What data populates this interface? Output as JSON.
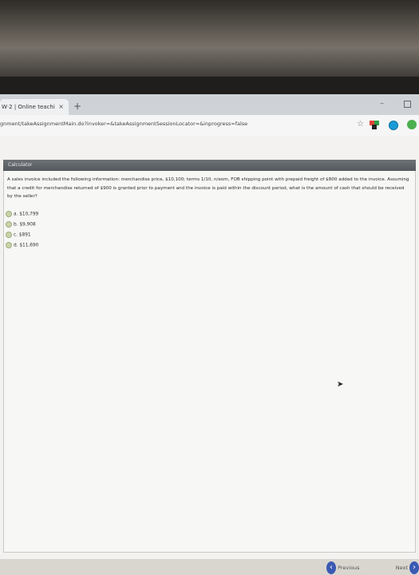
{
  "browser": {
    "tab_title": "W·2 | Online teachi",
    "tab_close": "×",
    "new_tab": "+",
    "url": "gnment/takeAssignmentMain.do?invoker=&takeAssignmentSessionLocator=&inprogress=false"
  },
  "calculator": {
    "label": "Calculator"
  },
  "question": {
    "text": "A sales invoice included the following information: merchandise price, $10,100; terms 1/10, n/eom, FOB shipping point with prepaid freight of $800 added to the invoice. Assuming that a credit for merchandise returned of $900 is granted prior to payment and the invoice is paid within the discount period, what is the amount of cash that should be received by the seller?",
    "options": [
      {
        "label": "a. $10,799"
      },
      {
        "label": "b. $9,908"
      },
      {
        "label": "c. $891"
      },
      {
        "label": "d. $11,690"
      }
    ]
  },
  "nav": {
    "previous": "Previous",
    "next": "Next"
  },
  "colors": {
    "nav_button": "#3a59b3",
    "header_bar": "#5f6468"
  }
}
